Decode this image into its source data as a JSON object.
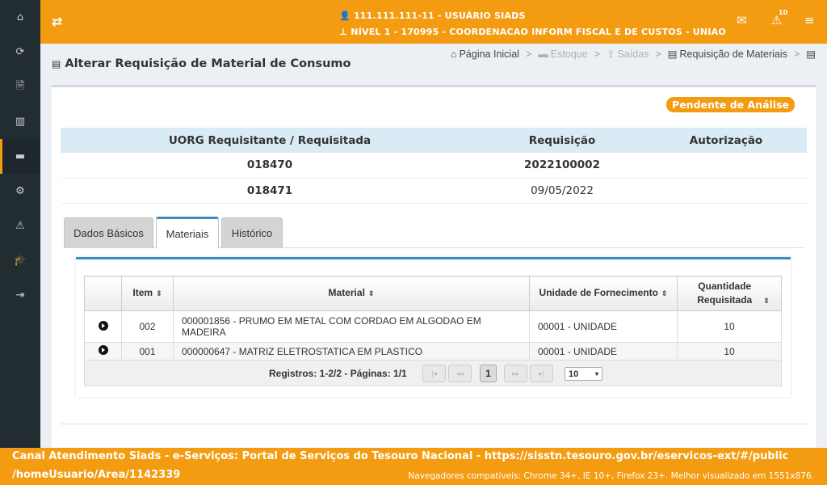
{
  "sidebar": {
    "items": [
      {
        "icon": "home-icon",
        "glyph": "⌂"
      },
      {
        "icon": "refresh-icon",
        "glyph": "⟳"
      },
      {
        "icon": "file-icon",
        "glyph": "🗎"
      },
      {
        "icon": "barcode-icon",
        "glyph": "▥"
      },
      {
        "icon": "archive-icon",
        "glyph": "▬"
      },
      {
        "icon": "cogs-icon",
        "glyph": "⚙"
      },
      {
        "icon": "warning-icon",
        "glyph": "⚠"
      },
      {
        "icon": "graduation-icon",
        "glyph": "🎓"
      },
      {
        "icon": "sign-in-icon",
        "glyph": "⇥"
      }
    ]
  },
  "header": {
    "user": "111.111.111-11 - USUÁRIO SIADS",
    "level": "NÍVEL 1 - 170995 - COORDENACAO INFORM FISCAL E DE CUSTOS - UNIAO",
    "alerts_count": "10",
    "accent": "#f39c12"
  },
  "page": {
    "title": "Alterar Requisição de Material de Consumo"
  },
  "breadcrumb": {
    "home": "Página Inicial",
    "estoque": "Estoque",
    "saidas": "Saídas",
    "requisicao": "Requisição de Materiais"
  },
  "status": "Pendente de Análise",
  "info": {
    "headers": [
      "UORG Requisitante / Requisitada",
      "Requisição",
      "Autorização"
    ],
    "uorg_requisitante": "018470",
    "requisicao_numero": "2022100002",
    "uorg_requisitada": "018471",
    "requisicao_data": "09/05/2022"
  },
  "tabs": [
    "Dados Básicos",
    "Materiais",
    "Histórico"
  ],
  "grid": {
    "headers": {
      "item": "Item",
      "material": "Material",
      "unidade": "Unidade de Fornecimento",
      "quantidade": "Quantidade Requisitada"
    },
    "rows": [
      {
        "item": "002",
        "material": "000001856 - PRUMO EM METAL COM CORDAO EM ALGODAO EM MADEIRA",
        "unidade": "00001 - UNIDADE",
        "quantidade": "10"
      },
      {
        "item": "001",
        "material": "000000647 - MATRIZ ELETROSTATICA EM PLASTICO",
        "unidade": "00001 - UNIDADE",
        "quantidade": "10"
      }
    ]
  },
  "pager": {
    "records": "Registros: 1-2/2 - Páginas: 1/1",
    "first": "|◂",
    "prev": "◂◂",
    "current": "1",
    "next": "▸▸",
    "last": "▸|",
    "page_size": "10"
  },
  "footer": {
    "line1": "Canal Atendimento Siads - e-Serviços: Portal de Serviços do Tesouro Nacional - https://sisstn.tesouro.gov.br/eservicos-ext/#/public",
    "line2": "/homeUsuario/Area/1142339",
    "browsers": "Navegadores compatíveis: Chrome 34+, IE 10+, Firefox 23+. Melhor visualizado em 1551x876."
  }
}
